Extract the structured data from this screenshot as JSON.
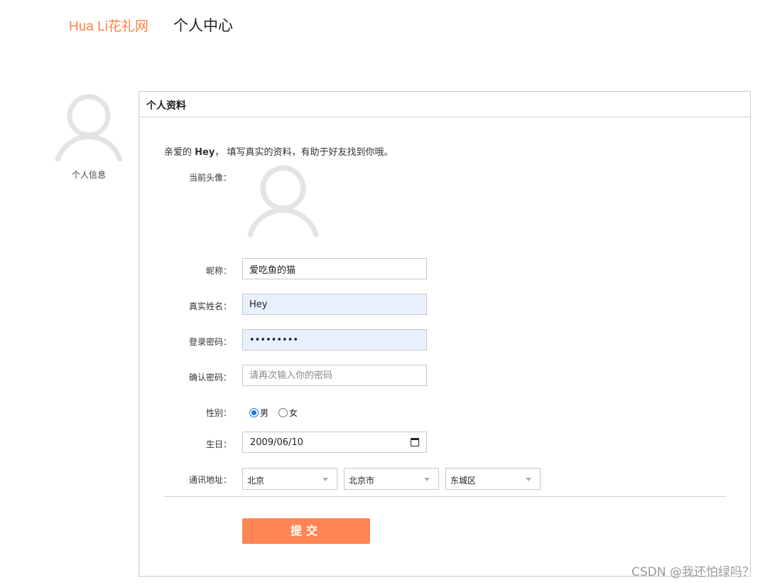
{
  "header": {
    "brand": "Hua Li花礼网",
    "title": "个人中心"
  },
  "sidebar": {
    "item_label": "个人信息"
  },
  "panel": {
    "title": "个人资料",
    "greeting_prefix": "亲爱的",
    "greeting_name": "Hey",
    "greeting_suffix": "， 填写真实的资料，有助于好友找到你哦。"
  },
  "form": {
    "avatar_label": "当前头像：",
    "nickname": {
      "label": "昵称：",
      "value": "爱吃鱼的猫"
    },
    "realname": {
      "label": "真实姓名：",
      "value": "Hey"
    },
    "password": {
      "label": "登录密码：",
      "value": "123456789"
    },
    "confirm": {
      "label": "确认密码：",
      "value": "",
      "placeholder": "请再次输入你的密码"
    },
    "gender": {
      "label": "性别：",
      "options": [
        "男",
        "女"
      ],
      "selected": "男"
    },
    "birthday": {
      "label": "生日：",
      "value": "2009/06/10"
    },
    "address": {
      "label": "通讯地址：",
      "province": "北京",
      "city": "北京市",
      "district": "东城区"
    },
    "submit_label": "提交"
  },
  "watermark": "CSDN @我还怕绿吗？",
  "colors": {
    "brand": "#ff7f45",
    "submit": "#ff8555",
    "autofill": "#e8f0fe",
    "avatar": "#e4e4e4"
  },
  "icons": [
    "user-avatar-icon",
    "calendar-icon",
    "chevron-down-icon"
  ]
}
